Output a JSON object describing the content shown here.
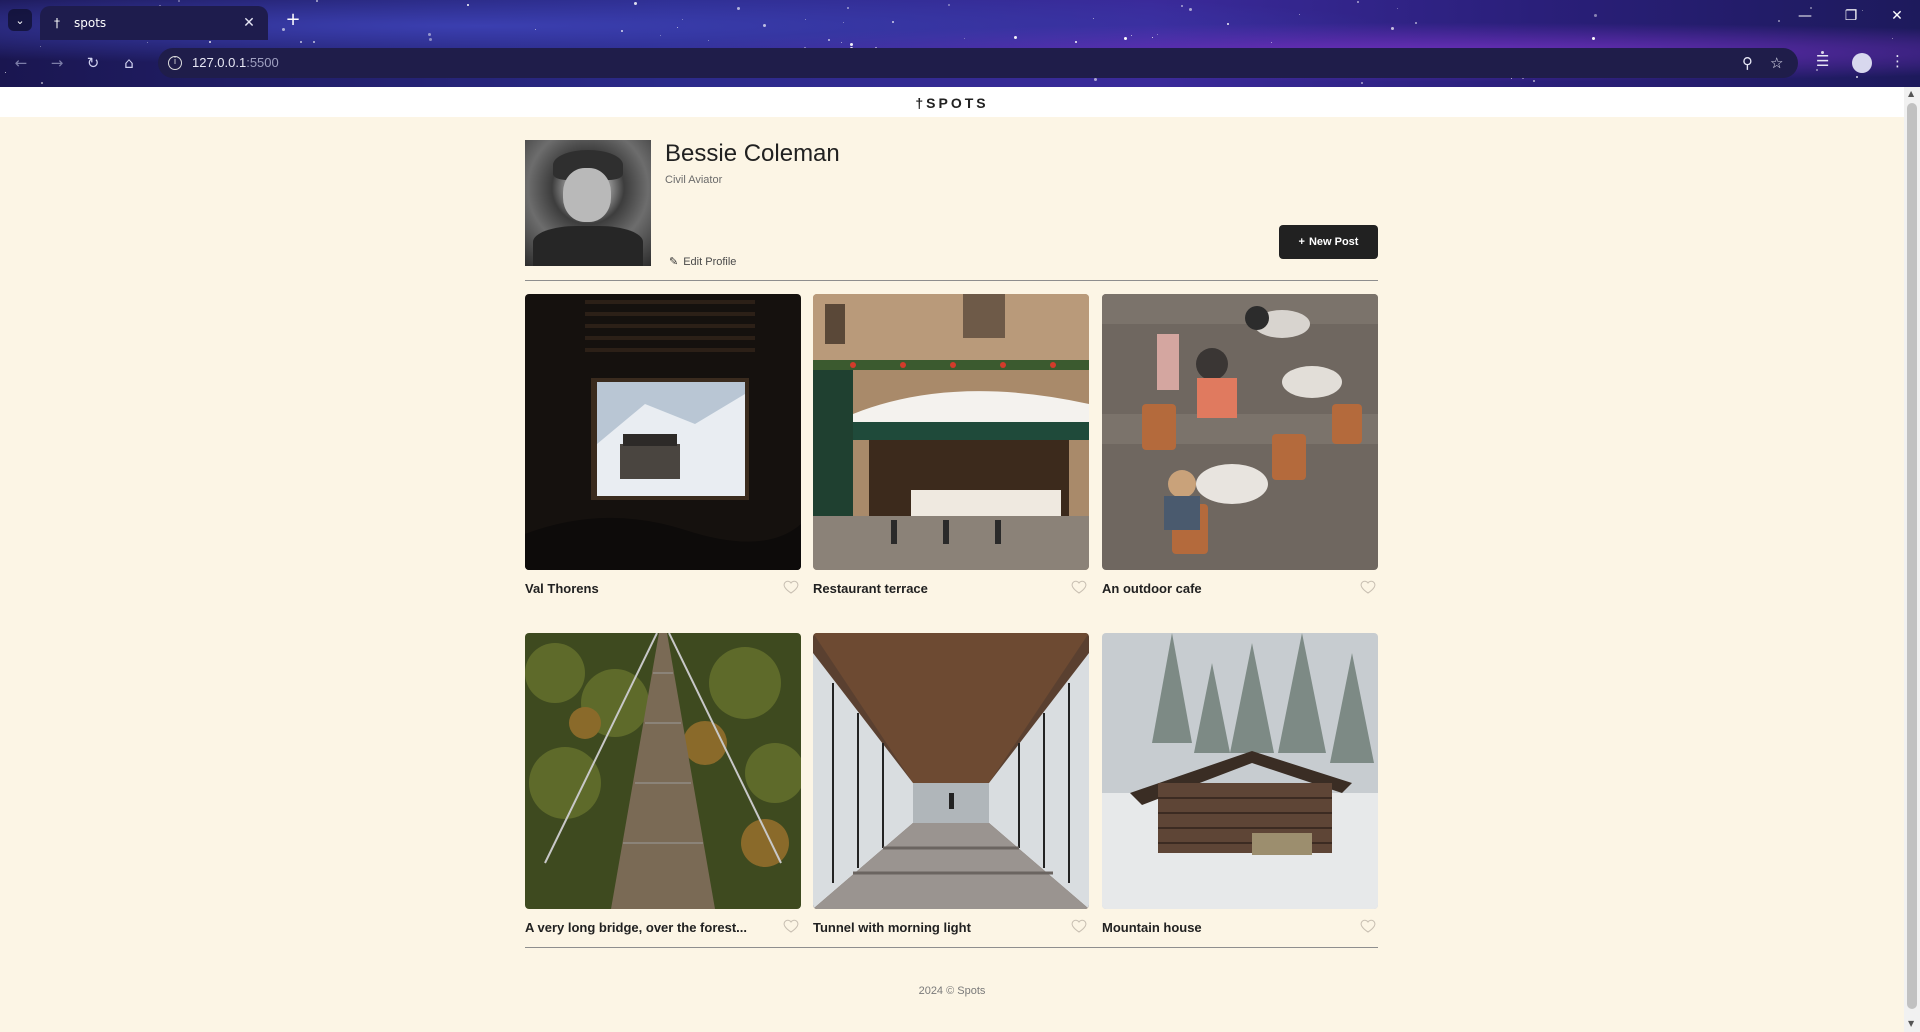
{
  "browser": {
    "tab_title": "spots",
    "url_host": "127.0.0.1",
    "url_port": ":5500"
  },
  "site": {
    "logo": "SPOTS"
  },
  "profile": {
    "name": "Bessie Coleman",
    "description": "Civil Aviator",
    "edit_label": "Edit Profile",
    "new_post_label": "New Post"
  },
  "cards": [
    {
      "title": "Val Thorens"
    },
    {
      "title": "Restaurant terrace"
    },
    {
      "title": "An outdoor cafe"
    },
    {
      "title": "A very long bridge, over the forest..."
    },
    {
      "title": "Tunnel with morning light"
    },
    {
      "title": "Mountain house"
    }
  ],
  "footer": {
    "text": "2024 © Spots"
  }
}
